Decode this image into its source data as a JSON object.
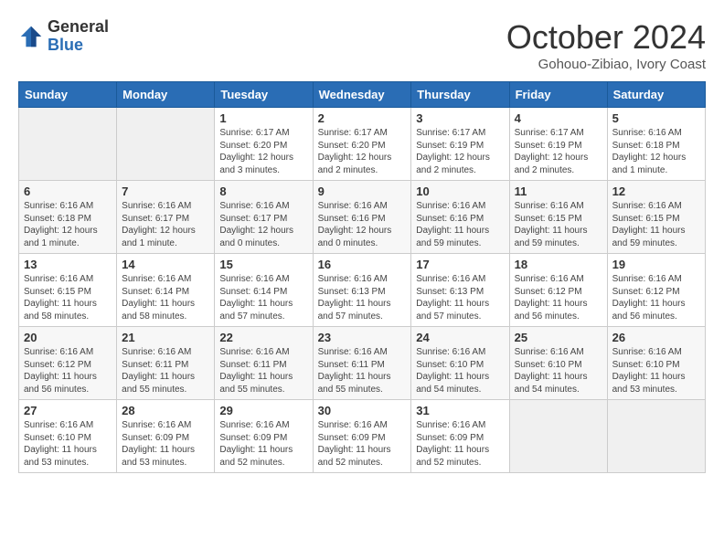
{
  "logo": {
    "general": "General",
    "blue": "Blue"
  },
  "title": "October 2024",
  "subtitle": "Gohouo-Zibiao, Ivory Coast",
  "columns": [
    "Sunday",
    "Monday",
    "Tuesday",
    "Wednesday",
    "Thursday",
    "Friday",
    "Saturday"
  ],
  "weeks": [
    [
      {
        "day": "",
        "info": ""
      },
      {
        "day": "",
        "info": ""
      },
      {
        "day": "1",
        "info": "Sunrise: 6:17 AM\nSunset: 6:20 PM\nDaylight: 12 hours and 3 minutes."
      },
      {
        "day": "2",
        "info": "Sunrise: 6:17 AM\nSunset: 6:20 PM\nDaylight: 12 hours and 2 minutes."
      },
      {
        "day": "3",
        "info": "Sunrise: 6:17 AM\nSunset: 6:19 PM\nDaylight: 12 hours and 2 minutes."
      },
      {
        "day": "4",
        "info": "Sunrise: 6:17 AM\nSunset: 6:19 PM\nDaylight: 12 hours and 2 minutes."
      },
      {
        "day": "5",
        "info": "Sunrise: 6:16 AM\nSunset: 6:18 PM\nDaylight: 12 hours and 1 minute."
      }
    ],
    [
      {
        "day": "6",
        "info": "Sunrise: 6:16 AM\nSunset: 6:18 PM\nDaylight: 12 hours and 1 minute."
      },
      {
        "day": "7",
        "info": "Sunrise: 6:16 AM\nSunset: 6:17 PM\nDaylight: 12 hours and 1 minute."
      },
      {
        "day": "8",
        "info": "Sunrise: 6:16 AM\nSunset: 6:17 PM\nDaylight: 12 hours and 0 minutes."
      },
      {
        "day": "9",
        "info": "Sunrise: 6:16 AM\nSunset: 6:16 PM\nDaylight: 12 hours and 0 minutes."
      },
      {
        "day": "10",
        "info": "Sunrise: 6:16 AM\nSunset: 6:16 PM\nDaylight: 11 hours and 59 minutes."
      },
      {
        "day": "11",
        "info": "Sunrise: 6:16 AM\nSunset: 6:15 PM\nDaylight: 11 hours and 59 minutes."
      },
      {
        "day": "12",
        "info": "Sunrise: 6:16 AM\nSunset: 6:15 PM\nDaylight: 11 hours and 59 minutes."
      }
    ],
    [
      {
        "day": "13",
        "info": "Sunrise: 6:16 AM\nSunset: 6:15 PM\nDaylight: 11 hours and 58 minutes."
      },
      {
        "day": "14",
        "info": "Sunrise: 6:16 AM\nSunset: 6:14 PM\nDaylight: 11 hours and 58 minutes."
      },
      {
        "day": "15",
        "info": "Sunrise: 6:16 AM\nSunset: 6:14 PM\nDaylight: 11 hours and 57 minutes."
      },
      {
        "day": "16",
        "info": "Sunrise: 6:16 AM\nSunset: 6:13 PM\nDaylight: 11 hours and 57 minutes."
      },
      {
        "day": "17",
        "info": "Sunrise: 6:16 AM\nSunset: 6:13 PM\nDaylight: 11 hours and 57 minutes."
      },
      {
        "day": "18",
        "info": "Sunrise: 6:16 AM\nSunset: 6:12 PM\nDaylight: 11 hours and 56 minutes."
      },
      {
        "day": "19",
        "info": "Sunrise: 6:16 AM\nSunset: 6:12 PM\nDaylight: 11 hours and 56 minutes."
      }
    ],
    [
      {
        "day": "20",
        "info": "Sunrise: 6:16 AM\nSunset: 6:12 PM\nDaylight: 11 hours and 56 minutes."
      },
      {
        "day": "21",
        "info": "Sunrise: 6:16 AM\nSunset: 6:11 PM\nDaylight: 11 hours and 55 minutes."
      },
      {
        "day": "22",
        "info": "Sunrise: 6:16 AM\nSunset: 6:11 PM\nDaylight: 11 hours and 55 minutes."
      },
      {
        "day": "23",
        "info": "Sunrise: 6:16 AM\nSunset: 6:11 PM\nDaylight: 11 hours and 55 minutes."
      },
      {
        "day": "24",
        "info": "Sunrise: 6:16 AM\nSunset: 6:10 PM\nDaylight: 11 hours and 54 minutes."
      },
      {
        "day": "25",
        "info": "Sunrise: 6:16 AM\nSunset: 6:10 PM\nDaylight: 11 hours and 54 minutes."
      },
      {
        "day": "26",
        "info": "Sunrise: 6:16 AM\nSunset: 6:10 PM\nDaylight: 11 hours and 53 minutes."
      }
    ],
    [
      {
        "day": "27",
        "info": "Sunrise: 6:16 AM\nSunset: 6:10 PM\nDaylight: 11 hours and 53 minutes."
      },
      {
        "day": "28",
        "info": "Sunrise: 6:16 AM\nSunset: 6:09 PM\nDaylight: 11 hours and 53 minutes."
      },
      {
        "day": "29",
        "info": "Sunrise: 6:16 AM\nSunset: 6:09 PM\nDaylight: 11 hours and 52 minutes."
      },
      {
        "day": "30",
        "info": "Sunrise: 6:16 AM\nSunset: 6:09 PM\nDaylight: 11 hours and 52 minutes."
      },
      {
        "day": "31",
        "info": "Sunrise: 6:16 AM\nSunset: 6:09 PM\nDaylight: 11 hours and 52 minutes."
      },
      {
        "day": "",
        "info": ""
      },
      {
        "day": "",
        "info": ""
      }
    ]
  ]
}
